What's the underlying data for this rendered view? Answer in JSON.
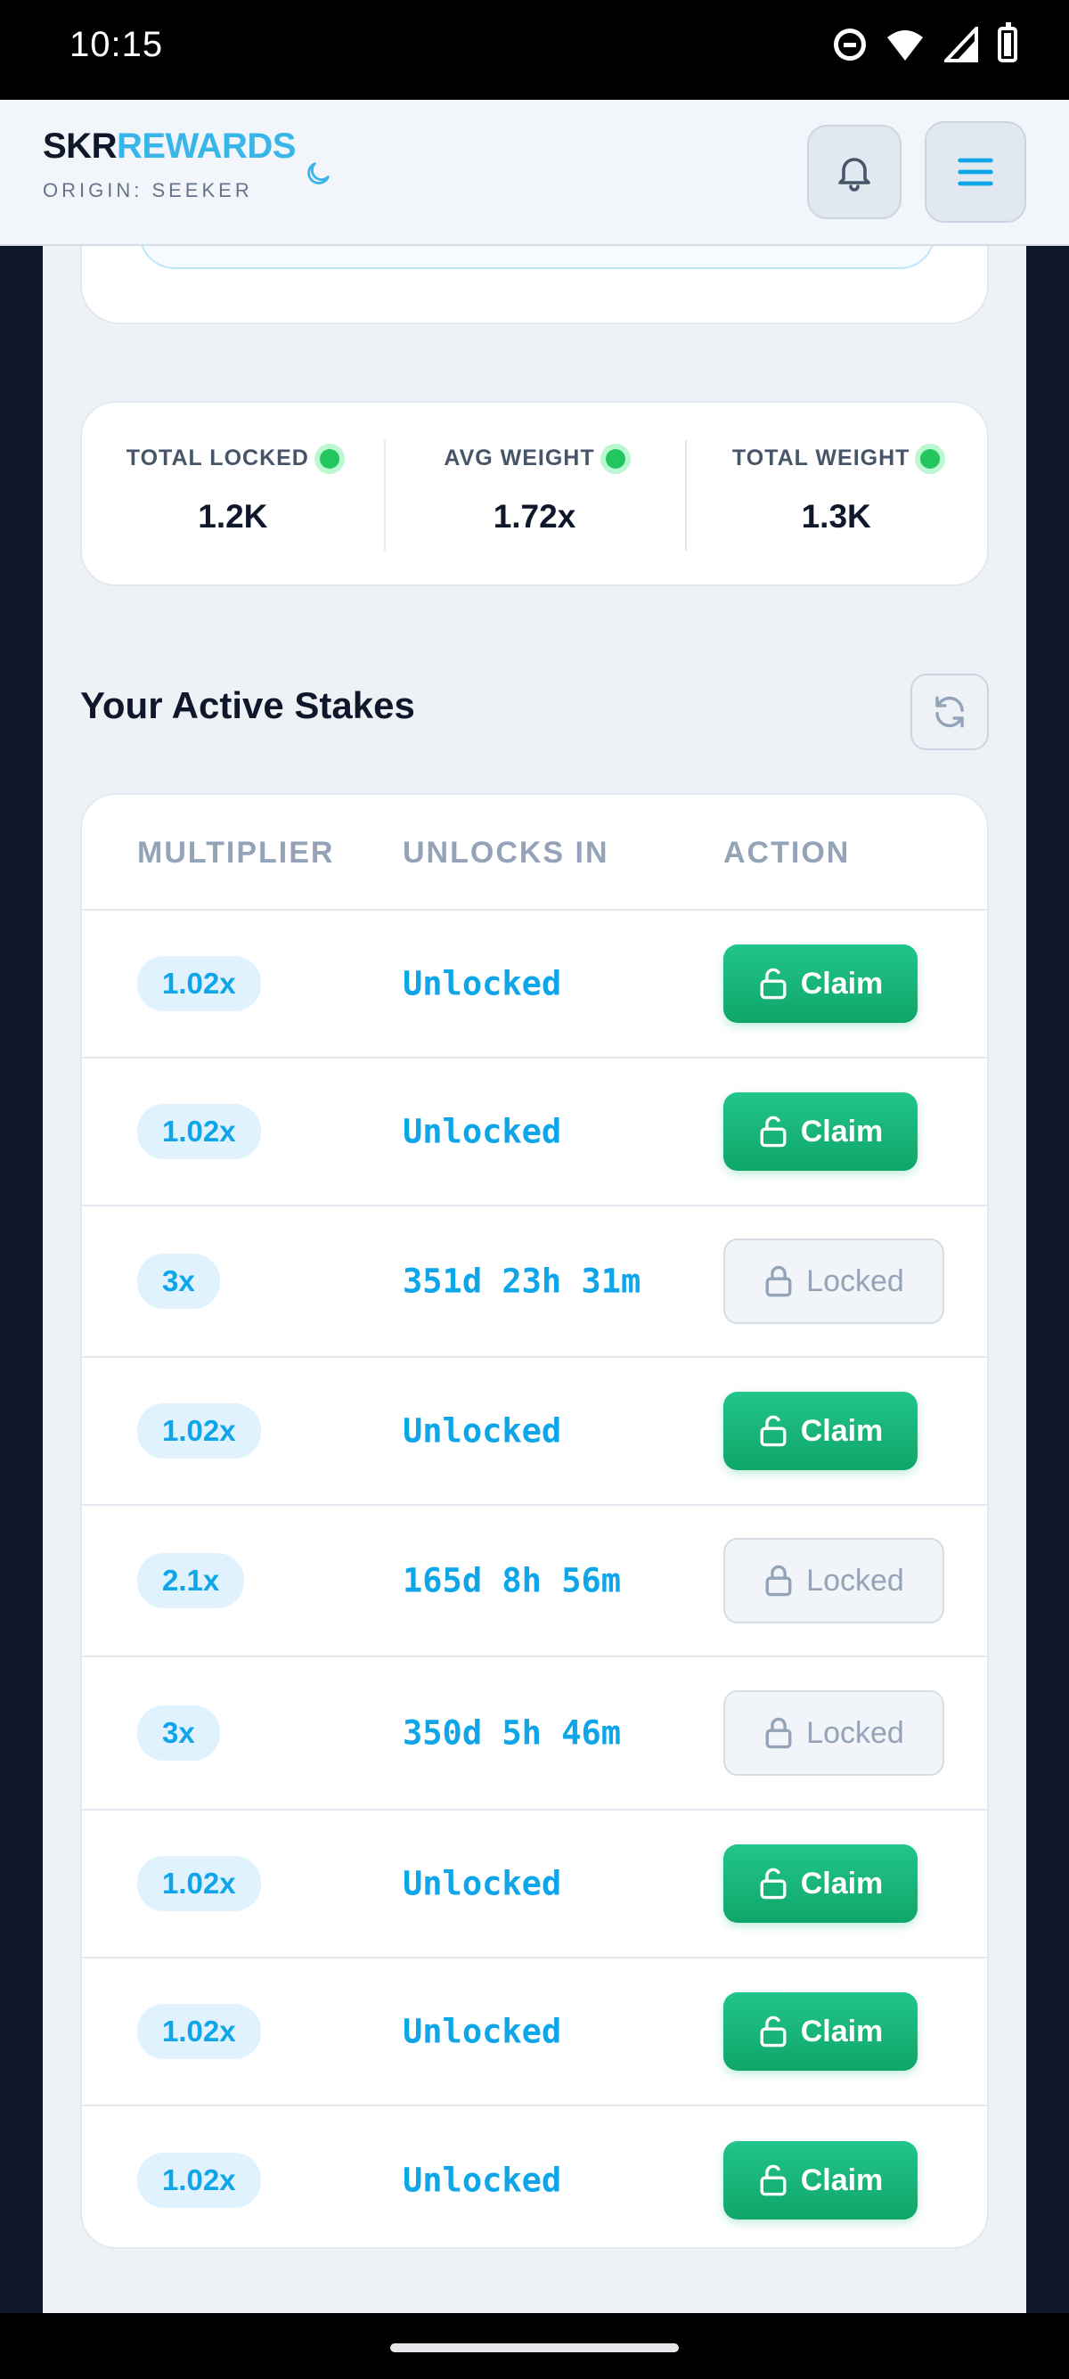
{
  "status_bar": {
    "time": "10:15"
  },
  "header": {
    "brand_primary": "SKR",
    "brand_accent": "REWARDS",
    "brand_subtitle": "ORIGIN: SEEKER",
    "theme_icon": "moon-icon",
    "notification_icon": "bell-icon",
    "menu_icon": "hamburger-icon"
  },
  "stats": [
    {
      "label": "TOTAL LOCKED",
      "value": "1.2K"
    },
    {
      "label": "AVG WEIGHT",
      "value": "1.72x"
    },
    {
      "label": "TOTAL WEIGHT",
      "value": "1.3K"
    }
  ],
  "stakes": {
    "title": "Your Active Stakes",
    "refresh_icon": "refresh-icon",
    "columns": [
      "MULTIPLIER",
      "UNLOCKS IN",
      "ACTION"
    ],
    "rows": [
      {
        "multiplier": "1.02x",
        "unlocks_in": "Unlocked",
        "action": "Claim"
      },
      {
        "multiplier": "1.02x",
        "unlocks_in": "Unlocked",
        "action": "Claim"
      },
      {
        "multiplier": "3x",
        "unlocks_in": "351d 23h 31m",
        "action": "Locked"
      },
      {
        "multiplier": "1.02x",
        "unlocks_in": "Unlocked",
        "action": "Claim"
      },
      {
        "multiplier": "2.1x",
        "unlocks_in": "165d 8h 56m",
        "action": "Locked"
      },
      {
        "multiplier": "3x",
        "unlocks_in": "350d 5h 46m",
        "action": "Locked"
      },
      {
        "multiplier": "1.02x",
        "unlocks_in": "Unlocked",
        "action": "Claim"
      },
      {
        "multiplier": "1.02x",
        "unlocks_in": "Unlocked",
        "action": "Claim"
      },
      {
        "multiplier": "1.02x",
        "unlocks_in": "Unlocked",
        "action": "Claim"
      }
    ]
  },
  "colors": {
    "accent": "#38b6ea",
    "claim": "#16b57a",
    "live_dot": "#22c55e"
  }
}
